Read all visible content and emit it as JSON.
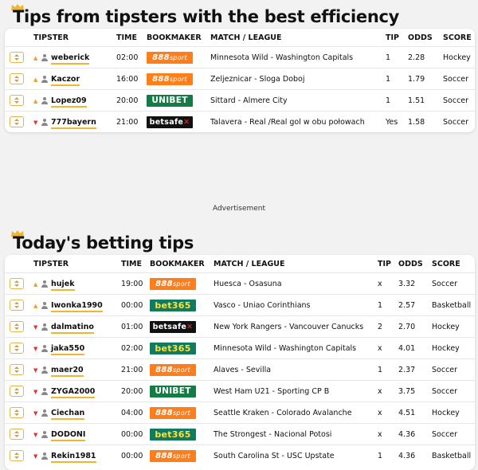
{
  "section1": {
    "title": "Tips from tipsters with the best efficiency",
    "headers": {
      "tipster": "TIPSTER",
      "time": "TIME",
      "bookmaker": "BOOKMAKER",
      "match": "MATCH / LEAGUE",
      "tip": "TIP",
      "odds": "ODDS",
      "score": "SCORE"
    },
    "rows": [
      {
        "trend": "up",
        "tipster": "weberick",
        "time": "02:00",
        "bookmaker": "888sport",
        "match": "Minnesota Wild - Washington Capitals",
        "tip": "1",
        "odds": "2.28",
        "score": "Hockey"
      },
      {
        "trend": "up",
        "tipster": "Kaczor",
        "time": "16:00",
        "bookmaker": "888sport",
        "match": "Zeljeznicar - Sloga Doboj",
        "tip": "1",
        "odds": "1.79",
        "score": "Soccer"
      },
      {
        "trend": "up",
        "tipster": "Lopez09",
        "time": "20:00",
        "bookmaker": "UNIBET",
        "match": "Sittard - Almere City",
        "tip": "1",
        "odds": "1.51",
        "score": "Soccer"
      },
      {
        "trend": "down",
        "tipster": "777bayern",
        "time": "21:00",
        "bookmaker": "betsafe",
        "match": "Talavera - Real /Real gol w obu połowach",
        "tip": "Yes",
        "odds": "1.58",
        "score": "Soccer"
      }
    ]
  },
  "advertisement": "Advertisement",
  "section2": {
    "title": "Today's betting tips",
    "headers": {
      "tipster": "TIPSTER",
      "time": "TIME",
      "bookmaker": "BOOKMAKER",
      "match": "MATCH / LEAGUE",
      "tip": "TIP",
      "odds": "ODDS",
      "score": "SCORE"
    },
    "rows": [
      {
        "trend": "up",
        "tipster": "hujek",
        "time": "19:00",
        "bookmaker": "888sport",
        "match": "Huesca - Osasuna",
        "tip": "x",
        "odds": "3.32",
        "score": "Soccer"
      },
      {
        "trend": "up",
        "tipster": "Iwonka1990",
        "time": "00:00",
        "bookmaker": "bet365",
        "match": "Vasco - Uniao Corinthians",
        "tip": "1",
        "odds": "2.57",
        "score": "Basketball"
      },
      {
        "trend": "down",
        "tipster": "dalmatino",
        "time": "01:00",
        "bookmaker": "betsafe",
        "match": "New York Rangers - Vancouver Canucks",
        "tip": "2",
        "odds": "2.70",
        "score": "Hockey"
      },
      {
        "trend": "down",
        "tipster": "jaka550",
        "time": "02:00",
        "bookmaker": "bet365",
        "match": "Minnesota Wild - Washington Capitals",
        "tip": "x",
        "odds": "4.01",
        "score": "Hockey"
      },
      {
        "trend": "down",
        "tipster": "maer20",
        "time": "21:00",
        "bookmaker": "888sport",
        "match": "Alaves - Sevilla",
        "tip": "1",
        "odds": "2.37",
        "score": "Soccer"
      },
      {
        "trend": "down",
        "tipster": "ZYGA2000",
        "time": "20:00",
        "bookmaker": "UNIBET",
        "match": "West Ham U21 - Sporting CP B",
        "tip": "x",
        "odds": "3.75",
        "score": "Soccer"
      },
      {
        "trend": "down",
        "tipster": "Ciechan",
        "time": "04:00",
        "bookmaker": "888sport",
        "match": "Seattle Kraken - Colorado Avalanche",
        "tip": "x",
        "odds": "4.51",
        "score": "Hockey"
      },
      {
        "trend": "down",
        "tipster": "DODONI",
        "time": "00:00",
        "bookmaker": "bet365",
        "match": "The Strongest - Nacional Potosi",
        "tip": "x",
        "odds": "4.36",
        "score": "Soccer"
      },
      {
        "trend": "down",
        "tipster": "Rekin1981",
        "time": "00:00",
        "bookmaker": "888sport",
        "match": "South Carolina St - USC Upstate",
        "tip": "1",
        "odds": "4.36",
        "score": "Basketball"
      }
    ]
  },
  "colors": {
    "accent": "#f2b530",
    "trend_up": "#f0a020",
    "trend_down": "#dd3333"
  }
}
